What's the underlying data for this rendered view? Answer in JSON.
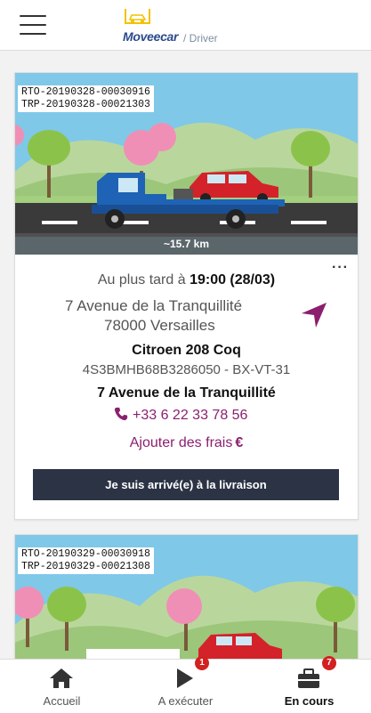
{
  "app": {
    "brand": "Moveecar",
    "brand_sub": "/ Driver"
  },
  "colors": {
    "accent": "#8b1f6e",
    "button_dark": "#2c3345",
    "badge_red": "#d32020",
    "sky": "#7fc8e8"
  },
  "missions": [
    {
      "rto": "RTO-20190328-00030916",
      "trp": "TRP-20190328-00021303",
      "distance": "~15.7 km",
      "deadline_prefix": "Au plus tard à",
      "deadline_time": "19:00 (28/03)",
      "address_line1": "7 Avenue de la Tranquillité",
      "address_line2": "78000 Versailles",
      "car_model": "Citroen 208 Coq",
      "car_ids": "4S3BMHB68B3286050 - BX-VT-31",
      "destination": "7 Avenue de la Tranquillité",
      "phone": "+33 6 22 33 78 56",
      "add_fees": "Ajouter des frais",
      "currency": "€",
      "action_label": "Je suis arrivé(e) à la livraison",
      "more_icon": "more-dots-icon",
      "nav_icon": "navigation-arrow-icon"
    },
    {
      "rto": "RTO-20190329-00030918",
      "trp": "TRP-20190329-00021308"
    }
  ],
  "tabs": [
    {
      "label": "Accueil",
      "icon": "home-icon"
    },
    {
      "label": "A exécuter",
      "icon": "play-icon",
      "badge": "1"
    },
    {
      "label": "En cours",
      "icon": "briefcase-icon",
      "badge": "7",
      "active": true
    }
  ]
}
